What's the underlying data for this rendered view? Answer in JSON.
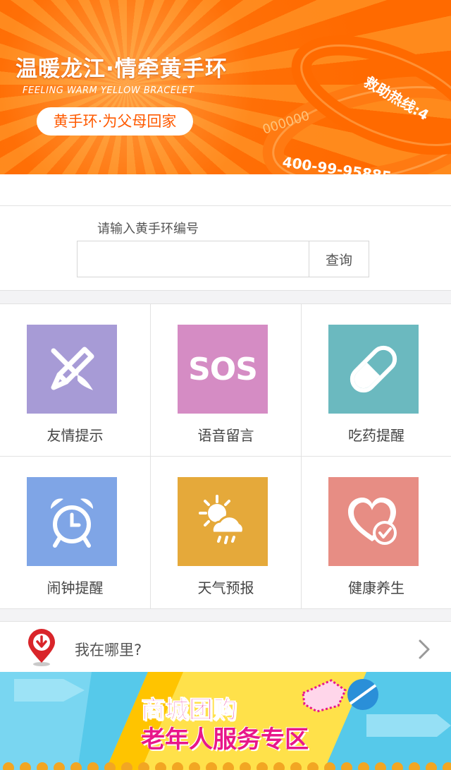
{
  "banner": {
    "title": "温暖龙江·情牵黄手环",
    "subtitle": "FEELING WARM YELLOW BRACELET",
    "pill": "黄手环·为父母回家",
    "bracelet_text_1": "救助热线:4",
    "bracelet_text_2": "400-99-95885",
    "bracelet_text_3": "000000",
    "accent_color": "#ff6a00"
  },
  "search": {
    "label": "请输入黄手环编号",
    "input_value": "",
    "placeholder": "",
    "button_label": "查询"
  },
  "features": [
    {
      "label": "友情提示",
      "icon": "pencil-brush-icon",
      "color": "#a79bd6"
    },
    {
      "label": "语音留言",
      "icon": "sos-icon",
      "text": "SOS",
      "color": "#d58cc4"
    },
    {
      "label": "吃药提醒",
      "icon": "pill-icon",
      "color": "#6bb9bf"
    },
    {
      "label": "闹钟提醒",
      "icon": "alarm-clock-icon",
      "color": "#7fa5e6"
    },
    {
      "label": "天气预报",
      "icon": "weather-icon",
      "color": "#e5a93a"
    },
    {
      "label": "健康养生",
      "icon": "heart-check-icon",
      "color": "#e78d84"
    }
  ],
  "location": {
    "label": "我在哪里?",
    "icon": "location-pin-icon"
  },
  "promo": {
    "line1": "商城团购",
    "line2": "老年人服务专区"
  }
}
